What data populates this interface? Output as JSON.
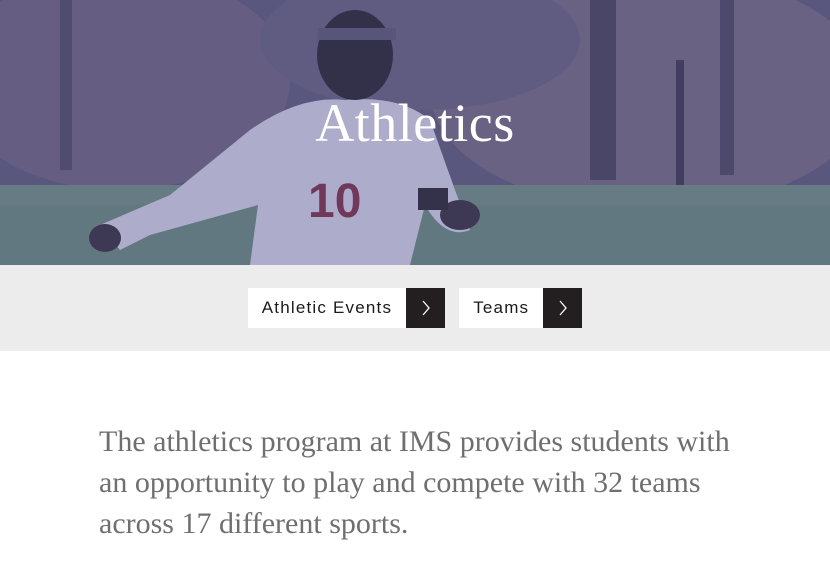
{
  "hero": {
    "title": "Athletics",
    "jersey_number": "10"
  },
  "subnav": {
    "items": [
      {
        "label": "Athletic Events",
        "icon": "chevron-right-icon"
      },
      {
        "label": "Teams",
        "icon": "chevron-right-icon"
      }
    ]
  },
  "intro": {
    "text": "The athletics program at IMS provides students with an opportunity to play and compete with 32 teams across 17 different sports."
  },
  "colors": {
    "hero_overlay": "#4b4b7d",
    "subnav_bg": "#ececed",
    "arrow_bg": "#231f20",
    "intro_text": "#6f6f6f"
  }
}
